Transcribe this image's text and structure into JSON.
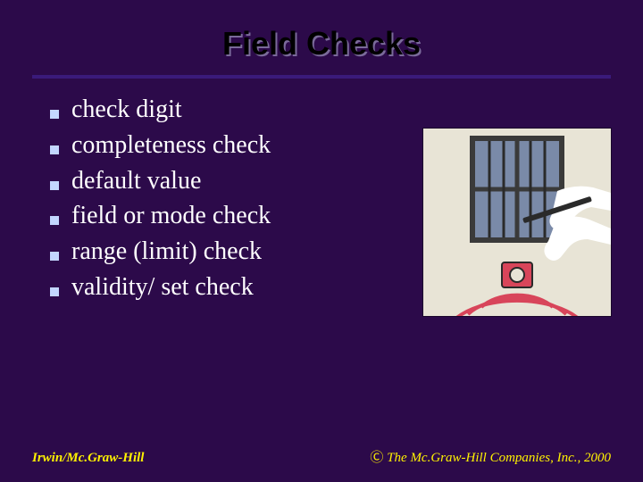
{
  "title": "Field Checks",
  "bullets": [
    "check digit",
    "completeness check",
    "default value",
    "field or mode check",
    "range (limit) check",
    "validity/ set  check"
  ],
  "footer": {
    "left": "Irwin/Mc.Graw-Hill",
    "copyright_symbol": "Ⓒ",
    "right": " The Mc.Graw-Hill Companies, Inc., 2000"
  },
  "image": {
    "alt": "burglar-alarm-illustration"
  }
}
